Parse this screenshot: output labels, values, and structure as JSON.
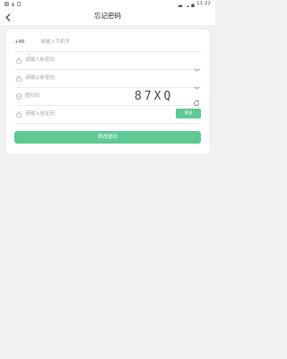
{
  "status_bar": {
    "time": "11:22"
  },
  "header": {
    "title": "忘记密码"
  },
  "form": {
    "country_code": "+86",
    "phone_placeholder": "请输入手机号",
    "new_password_placeholder": "请输入新密码",
    "confirm_password_placeholder": "请输认新密码",
    "captcha_placeholder": "图形码",
    "captcha_text": "87XQ",
    "sms_code_placeholder": "请输入验证码",
    "send_label": "发送",
    "submit_label": "修改密码"
  },
  "colors": {
    "accent": "#5ec994",
    "background": "#f1f1f1",
    "card": "#ffffff"
  },
  "icons": {
    "back": "chevron-left-icon",
    "lock": "lock-icon",
    "shield": "shield-icon",
    "eye": "eye-closed-icon",
    "refresh": "refresh-icon"
  }
}
